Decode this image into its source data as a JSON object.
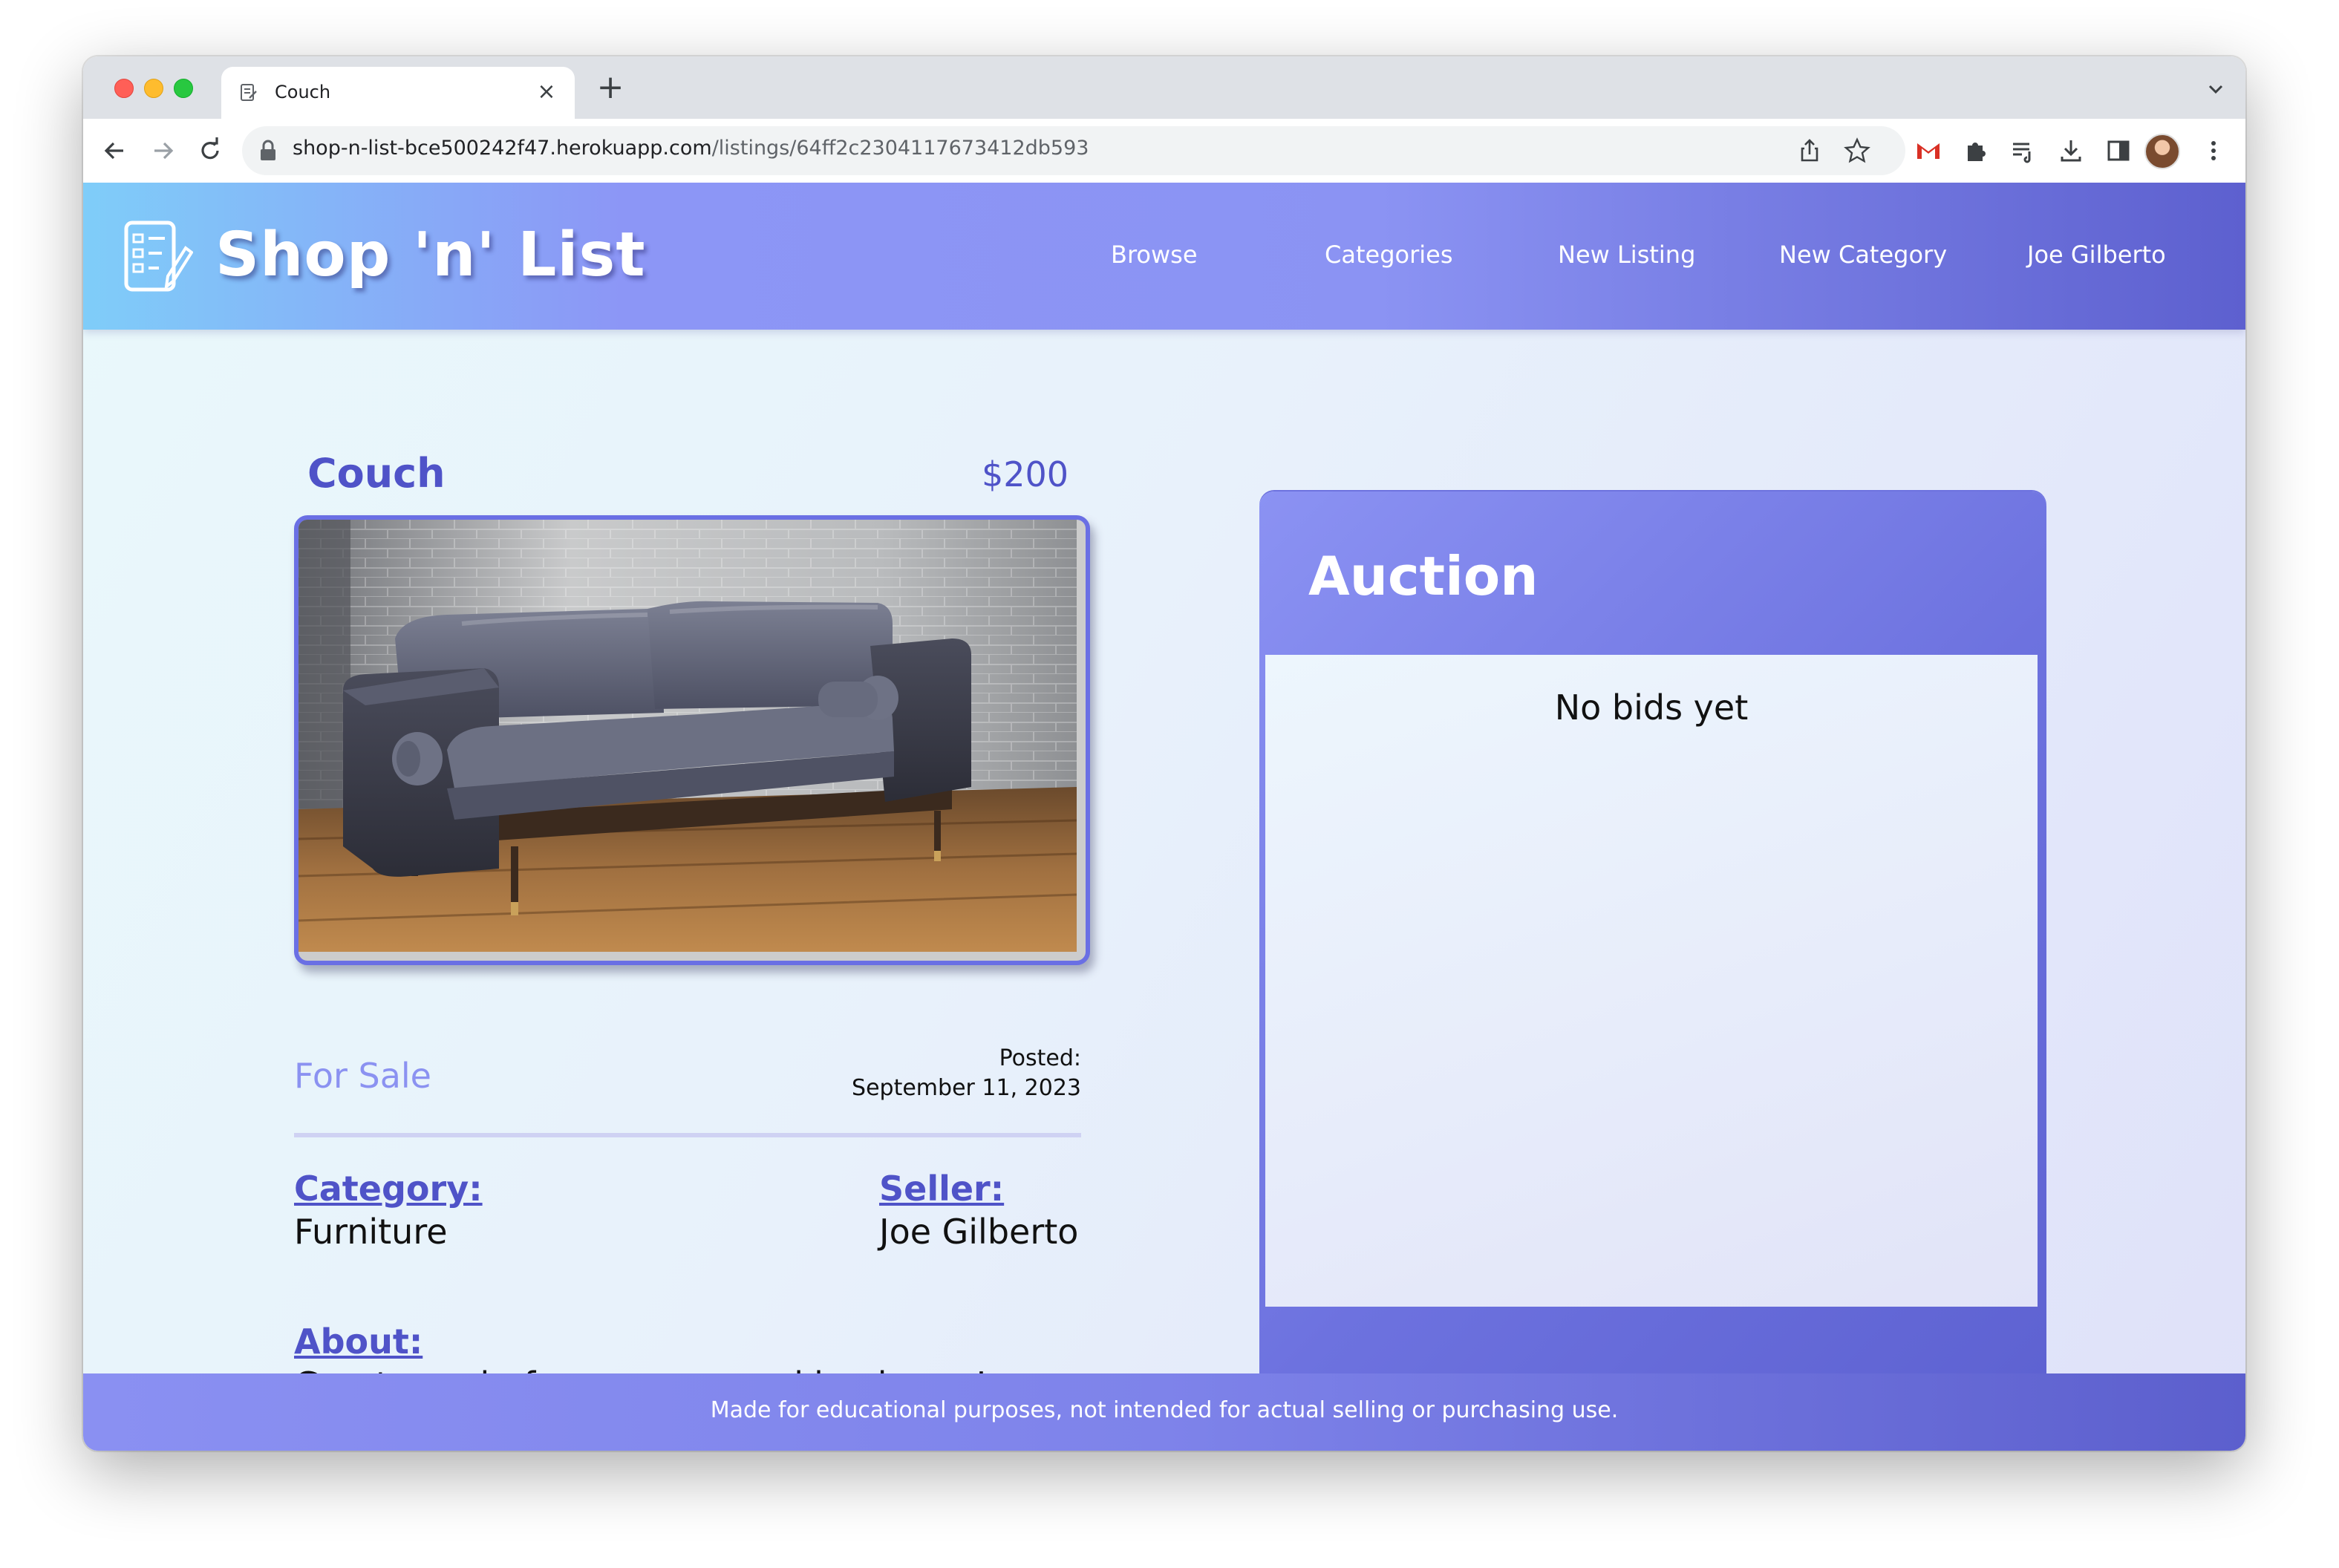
{
  "browser": {
    "tab_title": "Couch",
    "new_tab": "+",
    "close_tab": "×",
    "url_host": "shop-n-list-bce500242f47.herokuapp.com",
    "url_path": "/listings/64ff2c2304117673412db593"
  },
  "header": {
    "brand": "Shop 'n' List",
    "nav": [
      "Browse",
      "Categories",
      "New Listing",
      "New Category",
      "Joe Gilberto"
    ]
  },
  "listing": {
    "title": "Couch",
    "price": "$200",
    "status": "For Sale",
    "posted_label": "Posted:",
    "posted_date": "September 11, 2023",
    "category_label": "Category:",
    "category_value": "Furniture",
    "seller_label": "Seller:",
    "seller_value": "Joe Gilberto",
    "about_label": "About:",
    "about_value": "Great couch, from a non-smoking home!"
  },
  "auction": {
    "title": "Auction",
    "empty_text": "No bids yet"
  },
  "footer": {
    "text": "Made for educational purposes, not intended for actual selling or purchasing use."
  },
  "colors": {
    "accent": "#4f53c8",
    "status": "#8b92f1",
    "frame": "#6a6fe4"
  }
}
